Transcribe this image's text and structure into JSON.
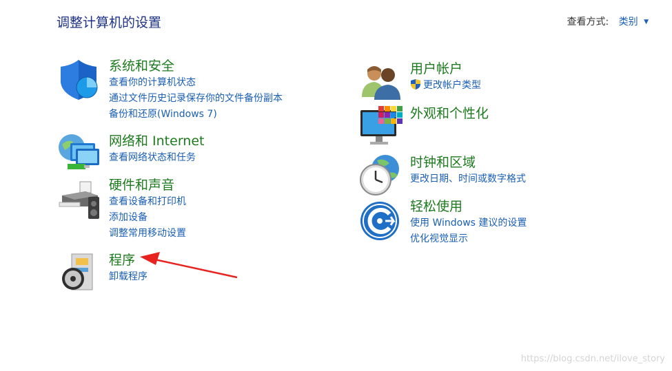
{
  "header": {
    "title": "调整计算机的设置"
  },
  "view_by": {
    "label": "查看方式:",
    "value": "类别"
  },
  "categories": {
    "system": {
      "icon": "system-security-shield-icon",
      "title": "系统和安全",
      "links": [
        "查看你的计算机状态",
        "通过文件历史记录保存你的文件备份副本",
        "备份和还原(Windows 7)"
      ]
    },
    "network": {
      "icon": "network-globe-icon",
      "title": "网络和 Internet",
      "links": [
        "查看网络状态和任务"
      ]
    },
    "hardware": {
      "icon": "printer-icon",
      "title": "硬件和声音",
      "links": [
        "查看设备和打印机",
        "添加设备",
        "调整常用移动设置"
      ]
    },
    "programs": {
      "icon": "programs-cd-icon",
      "title": "程序",
      "links": [
        "卸载程序"
      ]
    },
    "accounts": {
      "icon": "users-icon",
      "title": "用户帐户",
      "links": [
        "更改帐户类型"
      ]
    },
    "appearance": {
      "icon": "monitor-colors-icon",
      "title": "外观和个性化",
      "links": []
    },
    "clock": {
      "icon": "clock-globe-icon",
      "title": "时钟和区域",
      "links": [
        "更改日期、时间或数字格式"
      ]
    },
    "ease": {
      "icon": "ease-of-access-icon",
      "title": "轻松使用",
      "links": [
        "使用 Windows 建议的设置",
        "优化视觉显示"
      ]
    }
  },
  "annotation": {
    "color": "#e8231f"
  },
  "watermark": "https://blog.csdn.net/ilove_story"
}
